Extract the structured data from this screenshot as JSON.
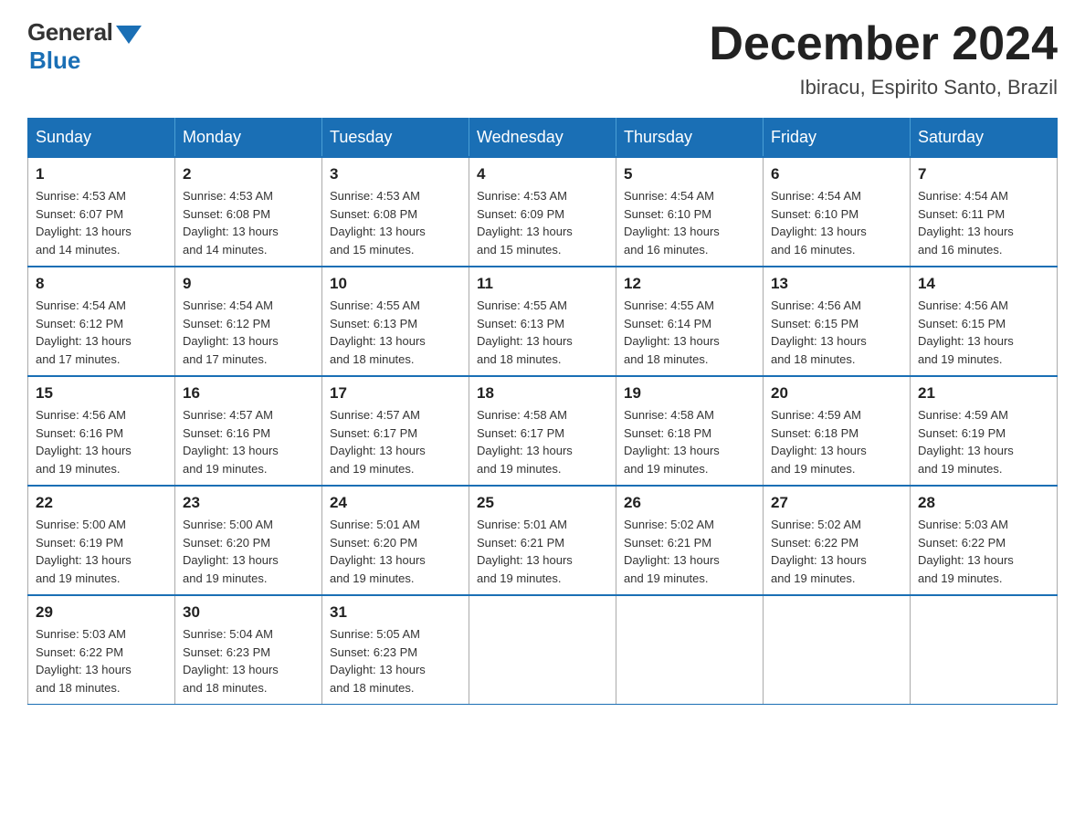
{
  "logo": {
    "general": "General",
    "blue": "Blue"
  },
  "title": {
    "month_year": "December 2024",
    "location": "Ibiracu, Espirito Santo, Brazil"
  },
  "days_of_week": [
    "Sunday",
    "Monday",
    "Tuesday",
    "Wednesday",
    "Thursday",
    "Friday",
    "Saturday"
  ],
  "weeks": [
    [
      {
        "day": "1",
        "sunrise": "4:53 AM",
        "sunset": "6:07 PM",
        "daylight": "13 hours and 14 minutes."
      },
      {
        "day": "2",
        "sunrise": "4:53 AM",
        "sunset": "6:08 PM",
        "daylight": "13 hours and 14 minutes."
      },
      {
        "day": "3",
        "sunrise": "4:53 AM",
        "sunset": "6:08 PM",
        "daylight": "13 hours and 15 minutes."
      },
      {
        "day": "4",
        "sunrise": "4:53 AM",
        "sunset": "6:09 PM",
        "daylight": "13 hours and 15 minutes."
      },
      {
        "day": "5",
        "sunrise": "4:54 AM",
        "sunset": "6:10 PM",
        "daylight": "13 hours and 16 minutes."
      },
      {
        "day": "6",
        "sunrise": "4:54 AM",
        "sunset": "6:10 PM",
        "daylight": "13 hours and 16 minutes."
      },
      {
        "day": "7",
        "sunrise": "4:54 AM",
        "sunset": "6:11 PM",
        "daylight": "13 hours and 16 minutes."
      }
    ],
    [
      {
        "day": "8",
        "sunrise": "4:54 AM",
        "sunset": "6:12 PM",
        "daylight": "13 hours and 17 minutes."
      },
      {
        "day": "9",
        "sunrise": "4:54 AM",
        "sunset": "6:12 PM",
        "daylight": "13 hours and 17 minutes."
      },
      {
        "day": "10",
        "sunrise": "4:55 AM",
        "sunset": "6:13 PM",
        "daylight": "13 hours and 18 minutes."
      },
      {
        "day": "11",
        "sunrise": "4:55 AM",
        "sunset": "6:13 PM",
        "daylight": "13 hours and 18 minutes."
      },
      {
        "day": "12",
        "sunrise": "4:55 AM",
        "sunset": "6:14 PM",
        "daylight": "13 hours and 18 minutes."
      },
      {
        "day": "13",
        "sunrise": "4:56 AM",
        "sunset": "6:15 PM",
        "daylight": "13 hours and 18 minutes."
      },
      {
        "day": "14",
        "sunrise": "4:56 AM",
        "sunset": "6:15 PM",
        "daylight": "13 hours and 19 minutes."
      }
    ],
    [
      {
        "day": "15",
        "sunrise": "4:56 AM",
        "sunset": "6:16 PM",
        "daylight": "13 hours and 19 minutes."
      },
      {
        "day": "16",
        "sunrise": "4:57 AM",
        "sunset": "6:16 PM",
        "daylight": "13 hours and 19 minutes."
      },
      {
        "day": "17",
        "sunrise": "4:57 AM",
        "sunset": "6:17 PM",
        "daylight": "13 hours and 19 minutes."
      },
      {
        "day": "18",
        "sunrise": "4:58 AM",
        "sunset": "6:17 PM",
        "daylight": "13 hours and 19 minutes."
      },
      {
        "day": "19",
        "sunrise": "4:58 AM",
        "sunset": "6:18 PM",
        "daylight": "13 hours and 19 minutes."
      },
      {
        "day": "20",
        "sunrise": "4:59 AM",
        "sunset": "6:18 PM",
        "daylight": "13 hours and 19 minutes."
      },
      {
        "day": "21",
        "sunrise": "4:59 AM",
        "sunset": "6:19 PM",
        "daylight": "13 hours and 19 minutes."
      }
    ],
    [
      {
        "day": "22",
        "sunrise": "5:00 AM",
        "sunset": "6:19 PM",
        "daylight": "13 hours and 19 minutes."
      },
      {
        "day": "23",
        "sunrise": "5:00 AM",
        "sunset": "6:20 PM",
        "daylight": "13 hours and 19 minutes."
      },
      {
        "day": "24",
        "sunrise": "5:01 AM",
        "sunset": "6:20 PM",
        "daylight": "13 hours and 19 minutes."
      },
      {
        "day": "25",
        "sunrise": "5:01 AM",
        "sunset": "6:21 PM",
        "daylight": "13 hours and 19 minutes."
      },
      {
        "day": "26",
        "sunrise": "5:02 AM",
        "sunset": "6:21 PM",
        "daylight": "13 hours and 19 minutes."
      },
      {
        "day": "27",
        "sunrise": "5:02 AM",
        "sunset": "6:22 PM",
        "daylight": "13 hours and 19 minutes."
      },
      {
        "day": "28",
        "sunrise": "5:03 AM",
        "sunset": "6:22 PM",
        "daylight": "13 hours and 19 minutes."
      }
    ],
    [
      {
        "day": "29",
        "sunrise": "5:03 AM",
        "sunset": "6:22 PM",
        "daylight": "13 hours and 18 minutes."
      },
      {
        "day": "30",
        "sunrise": "5:04 AM",
        "sunset": "6:23 PM",
        "daylight": "13 hours and 18 minutes."
      },
      {
        "day": "31",
        "sunrise": "5:05 AM",
        "sunset": "6:23 PM",
        "daylight": "13 hours and 18 minutes."
      },
      null,
      null,
      null,
      null
    ]
  ],
  "labels": {
    "sunrise": "Sunrise:",
    "sunset": "Sunset:",
    "daylight": "Daylight:"
  }
}
